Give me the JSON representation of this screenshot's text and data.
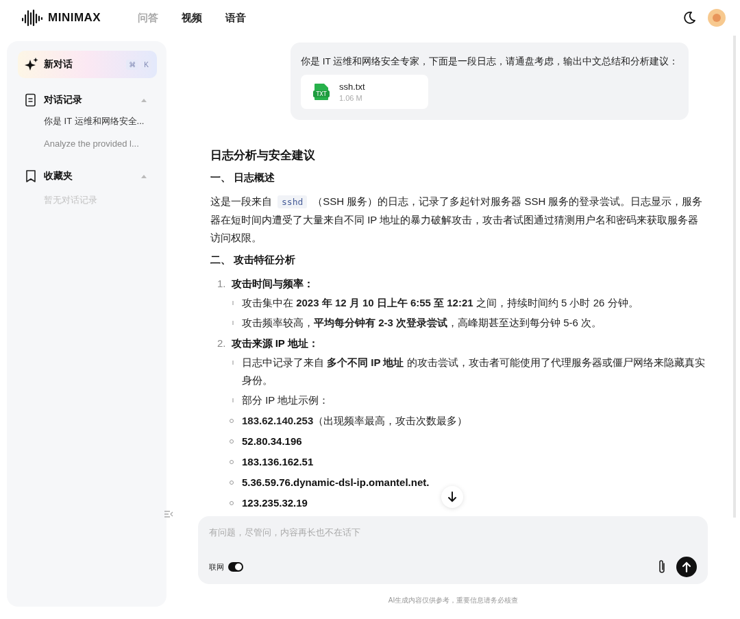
{
  "header": {
    "logo": "MINIMAX",
    "tabs": [
      {
        "label": "问答",
        "selected": true
      },
      {
        "label": "视频",
        "selected": false
      },
      {
        "label": "语音",
        "selected": false
      }
    ]
  },
  "sidebar": {
    "new_chat": {
      "label": "新对话",
      "shortcut": [
        "⌘",
        "K"
      ]
    },
    "sections": [
      {
        "kind": "history",
        "title": "对话记录",
        "expanded": true,
        "items": [
          "你是 IT 运维和网络安全...",
          "Analyze the provided l..."
        ]
      },
      {
        "kind": "favorites",
        "title": "收藏夹",
        "expanded": true,
        "empty_text": "暂无对话记录"
      }
    ]
  },
  "chat": {
    "user_message": {
      "text": "你是 IT 运维和网络安全专家，下面是一段日志，请通盘考虑，输出中文总结和分析建议：",
      "attachment": {
        "type": "TXT",
        "name": "ssh.txt",
        "size": "1.06 M"
      }
    },
    "answer": [
      {
        "kind": "title",
        "text": "日志分析与安全建议"
      },
      {
        "kind": "heading",
        "text": "一、 日志概述"
      },
      {
        "kind": "paragraph",
        "parts": [
          {
            "kind": "text",
            "text": "这是一段来自"
          },
          {
            "kind": "code",
            "text": "sshd"
          },
          {
            "kind": "text",
            "text": "（SSH 服务）的日志，记录了多起针对服务器 SSH 服务的登录尝试。日志显示，服务器在短时间内遭受了大量来自不同 IP 地址的暴力破解攻击，攻击者试图通过猜测用户名和密码来获取服务器访问权限。"
          }
        ]
      },
      {
        "kind": "heading",
        "text": "二、 攻击特征分析"
      },
      {
        "kind": "numbered_list",
        "items": [
          {
            "number": "1.",
            "text": "攻击时间与频率：",
            "bold": true,
            "children": [
              {
                "text": "攻击集中在 **2023 年 12 月 10 日上午 6:55 至 12:21** 之间，持续时间约 5 小时 26 分钟。",
                "bold": false
              },
              {
                "text": "攻击频率较高，**平均每分钟有 2-3 次登录尝试**，高峰期甚至达到每分钟 5-6 次。",
                "bold": false
              }
            ]
          },
          {
            "number": "2.",
            "text": "攻击来源 IP 地址：",
            "bold": true,
            "children": [
              {
                "text": "日志中记录了来自 **多个不同 IP 地址** 的攻击尝试，攻击者可能使用了代理服务器或僵尸网络来隐藏真实身份。",
                "bold": false
              },
              {
                "text": "部分 IP 地址示例：",
                "bold": false,
                "children": [
                  {
                    "text": "**183.62.140.253**（出现频率最高，攻击次数最多）",
                    "bold": false
                  },
                  {
                    "text": "52.80.34.196",
                    "bold": true
                  },
                  {
                    "text": "183.136.162.51",
                    "bold": true
                  },
                  {
                    "text": "5.36.59.76.dynamic-dsl-ip.omantel.net.",
                    "bold": true
                  },
                  {
                    "text": "123.235.32.19",
                    "bold": true
                  }
                ]
              }
            ]
          }
        ]
      }
    ]
  },
  "composer": {
    "placeholder": "有问题，尽管问，内容再长也不在话下",
    "web_search": {
      "label": "联网",
      "on": true
    }
  },
  "footer_note": "AI生成内容仅供参考，重要信息请务必核查"
}
